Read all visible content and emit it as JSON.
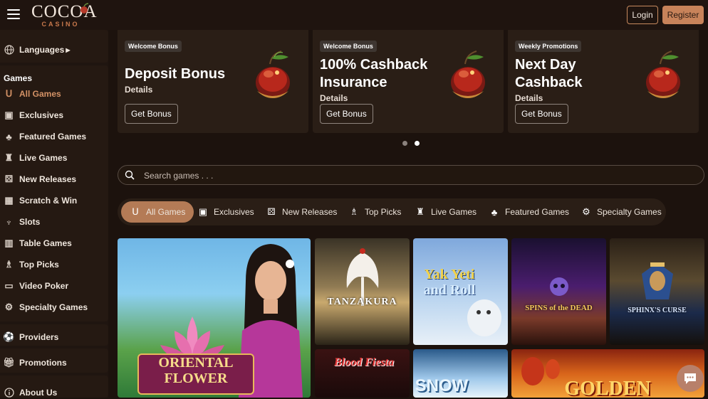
{
  "header": {
    "logo_main": "COCOA",
    "logo_sub": "CASINO",
    "login_label": "Login",
    "register_label": "Register"
  },
  "sidebar": {
    "languages_label": "Languages",
    "games_heading": "Games",
    "items": [
      {
        "label": "All Games",
        "icon": "horseshoe-icon",
        "active": true
      },
      {
        "label": "Exclusives",
        "icon": "exclusive-icon"
      },
      {
        "label": "Featured Games",
        "icon": "clover-icon"
      },
      {
        "label": "Live Games",
        "icon": "live-dealer-icon"
      },
      {
        "label": "New Releases",
        "icon": "dice-icon"
      },
      {
        "label": "Scratch & Win",
        "icon": "scratch-card-icon"
      },
      {
        "label": "Slots",
        "icon": "slot-lever-icon"
      },
      {
        "label": "Table Games",
        "icon": "table-icon"
      },
      {
        "label": "Top Picks",
        "icon": "top-picks-icon"
      },
      {
        "label": "Video Poker",
        "icon": "monitor-icon"
      },
      {
        "label": "Specialty Games",
        "icon": "gear-icon"
      }
    ],
    "providers_label": "Providers",
    "promotions_label": "Promotions",
    "about_label": "About Us"
  },
  "banners": [
    {
      "tag": "Welcome Bonus",
      "title": "Deposit Bonus",
      "details": "Details",
      "button": "Get Bonus"
    },
    {
      "tag": "Welcome Bonus",
      "title_line1": "100% Cashback",
      "title_line2": "Insurance",
      "details": "Details",
      "button": "Get Bonus"
    },
    {
      "tag": "Weekly Promotions",
      "title_line1": "Next Day",
      "title_line2": "Cashback",
      "details": "Details",
      "button": "Get Bonus"
    }
  ],
  "carousel": {
    "dots": 2,
    "active_index": 1
  },
  "search": {
    "placeholder": "Search games . . ."
  },
  "tabs": [
    {
      "label": "All Games",
      "icon": "horseshoe-icon",
      "active": true
    },
    {
      "label": "Exclusives",
      "icon": "exclusive-icon"
    },
    {
      "label": "New Releases",
      "icon": "dice-icon"
    },
    {
      "label": "Top Picks",
      "icon": "top-picks-icon"
    },
    {
      "label": "Live Games",
      "icon": "live-dealer-icon"
    },
    {
      "label": "Featured Games",
      "icon": "clover-icon"
    },
    {
      "label": "Specialty Games",
      "icon": "gear-icon"
    }
  ],
  "games": [
    {
      "line1": "ORIENTAL",
      "line2": "FLOWER"
    },
    {
      "title": "TANZAKURA"
    },
    {
      "line1": "Yak Yeti",
      "line2": "and Roll"
    },
    {
      "title": "SPINS of the DEAD"
    },
    {
      "title": "SPHINX'S CURSE"
    },
    {
      "title": "Blood Fiesta"
    },
    {
      "title": "SNOW"
    },
    {
      "title": "GOLDEN"
    }
  ],
  "colors": {
    "accent": "#c8835a",
    "background": "#1c120d",
    "panel": "#2a1e16",
    "active_text": "#d49266"
  }
}
